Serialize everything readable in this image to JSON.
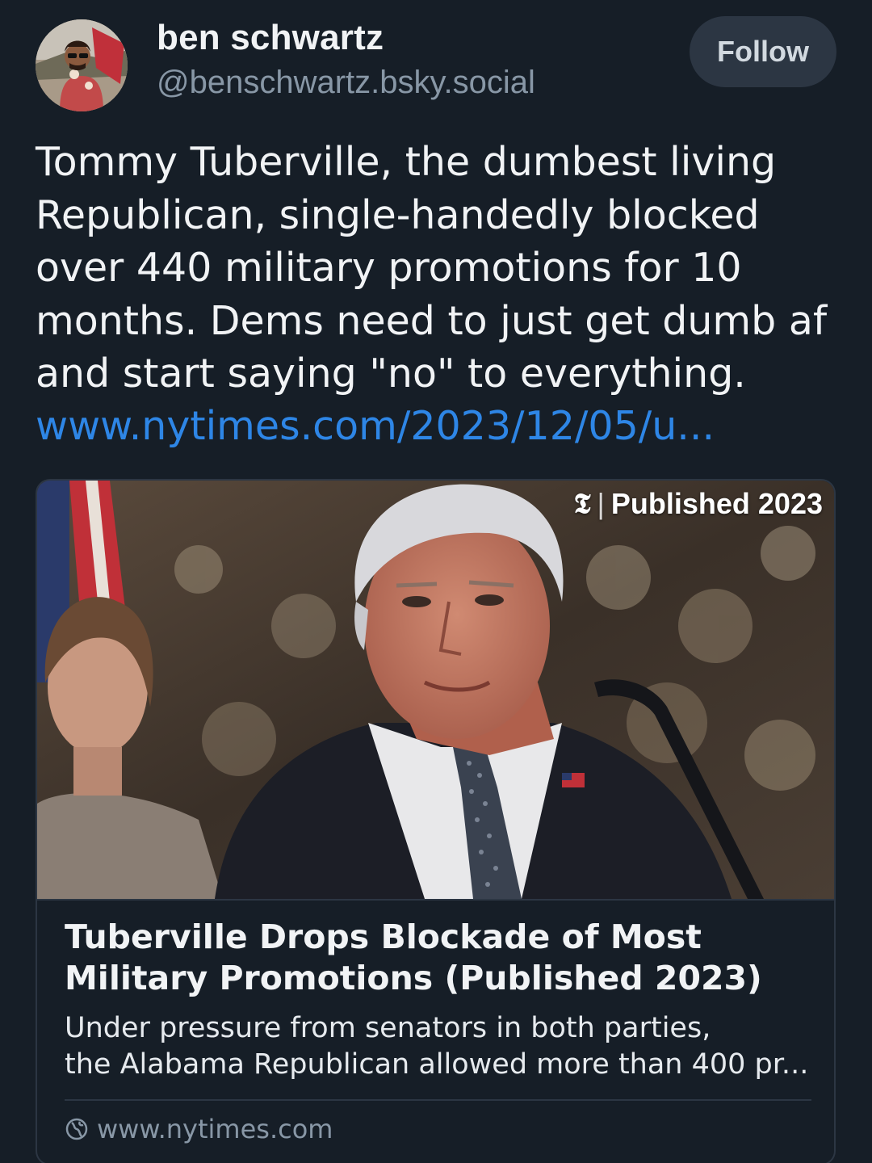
{
  "author": {
    "name": "ben schwartz",
    "handle": "@benschwartz.bsky.social",
    "avatar": "profile-photo"
  },
  "follow_button": {
    "label": "Follow"
  },
  "post": {
    "text": "Tommy Tuberville, the dumbest living\nRepublican, single-handedly blocked\nover 440 military promotions for 10\nmonths.  Dems need to just get dumb af\nand start saying \"no\" to everything.",
    "link_text": "www.nytimes.com/2023/12/05/u..."
  },
  "link_card": {
    "badge_icon": "𝕿",
    "badge_separator": "|",
    "badge_text": "Published 2023",
    "title": "Tuberville Drops Blockade of Most Military Promotions (Published 2023)",
    "description": "Under pressure from senators in both parties,\nthe Alabama Republican allowed more than 400 pr...",
    "domain": "www.nytimes.com",
    "domain_icon": "globe-icon"
  },
  "colors": {
    "background": "#161e27",
    "link": "#2e86e6",
    "muted": "#8897a6",
    "button_bg": "#2c3643"
  }
}
